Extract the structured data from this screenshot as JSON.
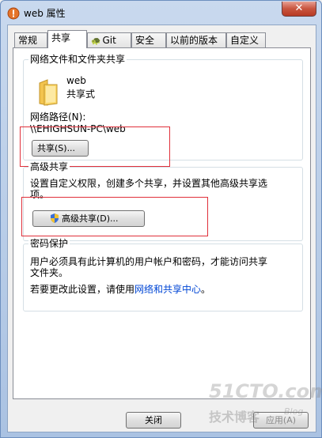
{
  "window": {
    "title": "web 属性",
    "close_label": "✕"
  },
  "tabs": [
    {
      "label": "常规"
    },
    {
      "label": "共享"
    },
    {
      "label": "Git"
    },
    {
      "label": "安全"
    },
    {
      "label": "以前的版本"
    },
    {
      "label": "自定义"
    }
  ],
  "active_tab": "共享",
  "network_share": {
    "title": "网络文件和文件夹共享",
    "folder_name": "web",
    "share_status": "共享式",
    "path_label": "网络路径(N):",
    "path_value": "\\\\EHIGHSUN-PC\\web",
    "share_button": "共享(S)..."
  },
  "advanced_share": {
    "title": "高级共享",
    "description_line1": "设置自定义权限，创建多个共享，并设置其他高级共享选",
    "description_line2": "项。",
    "button": "高级共享(D)..."
  },
  "password_protection": {
    "title": "密码保护",
    "line1": "用户必须具有此计算机的用户帐户和密码，才能访问共享",
    "line2": "文件夹。",
    "line3_prefix": "若要更改此设置，请使用",
    "link": "网络和共享中心",
    "line3_suffix": "。"
  },
  "footer": {
    "close_button": "关闭",
    "apply_button": "应用(A)"
  },
  "watermark": {
    "brand": "51CTO.com",
    "sub": "技术博客",
    "tag": "Blog"
  },
  "colors": {
    "highlight_box": "#e0303a",
    "link": "#0046d5"
  }
}
